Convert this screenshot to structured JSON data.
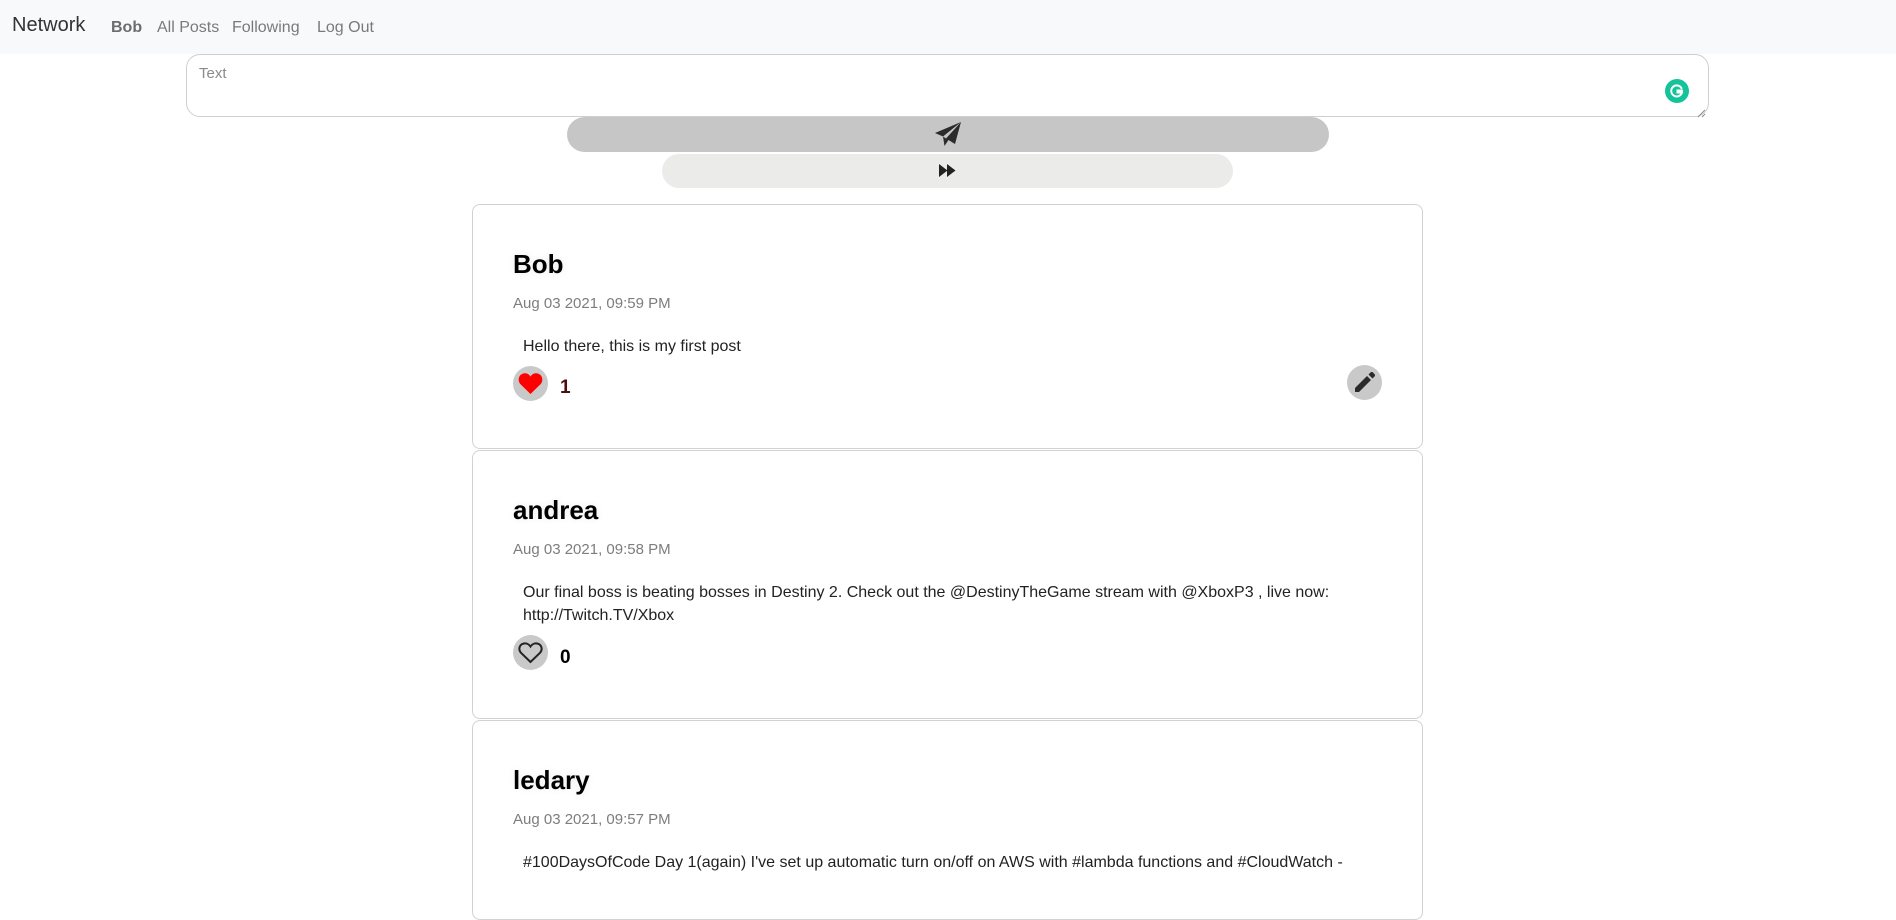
{
  "nav": {
    "brand": "Network",
    "user": "Bob",
    "all_posts": "All Posts",
    "following": "Following",
    "logout": "Log Out"
  },
  "compose": {
    "placeholder": "Text",
    "value": ""
  },
  "icons": {
    "send": "paper-plane-icon",
    "next": "fast-forward-icon",
    "like_filled": "heart-filled-icon",
    "like_outline": "heart-outline-icon",
    "edit": "pencil-icon",
    "grammarly": "grammarly-icon"
  },
  "colors": {
    "like_active": "#ff0000",
    "grammarly": "#15c39a"
  },
  "posts": [
    {
      "author": "Bob",
      "timestamp": "Aug 03 2021, 09:59 PM",
      "content": "Hello there, this is my first post",
      "likes": "1",
      "liked": true,
      "editable": true
    },
    {
      "author": "andrea",
      "timestamp": "Aug 03 2021, 09:58 PM",
      "content": "Our final boss is beating bosses in Destiny 2. Check out the @DestinyTheGame stream with @XboxP3 , live now: http://Twitch.TV/Xbox",
      "likes": "0",
      "liked": false,
      "editable": false
    },
    {
      "author": "ledary",
      "timestamp": "Aug 03 2021, 09:57 PM",
      "content": "#100DaysOfCode Day 1(again) I've set up automatic turn on/off on AWS with #lambda functions and #CloudWatch -",
      "likes": "",
      "liked": false,
      "editable": false
    }
  ]
}
